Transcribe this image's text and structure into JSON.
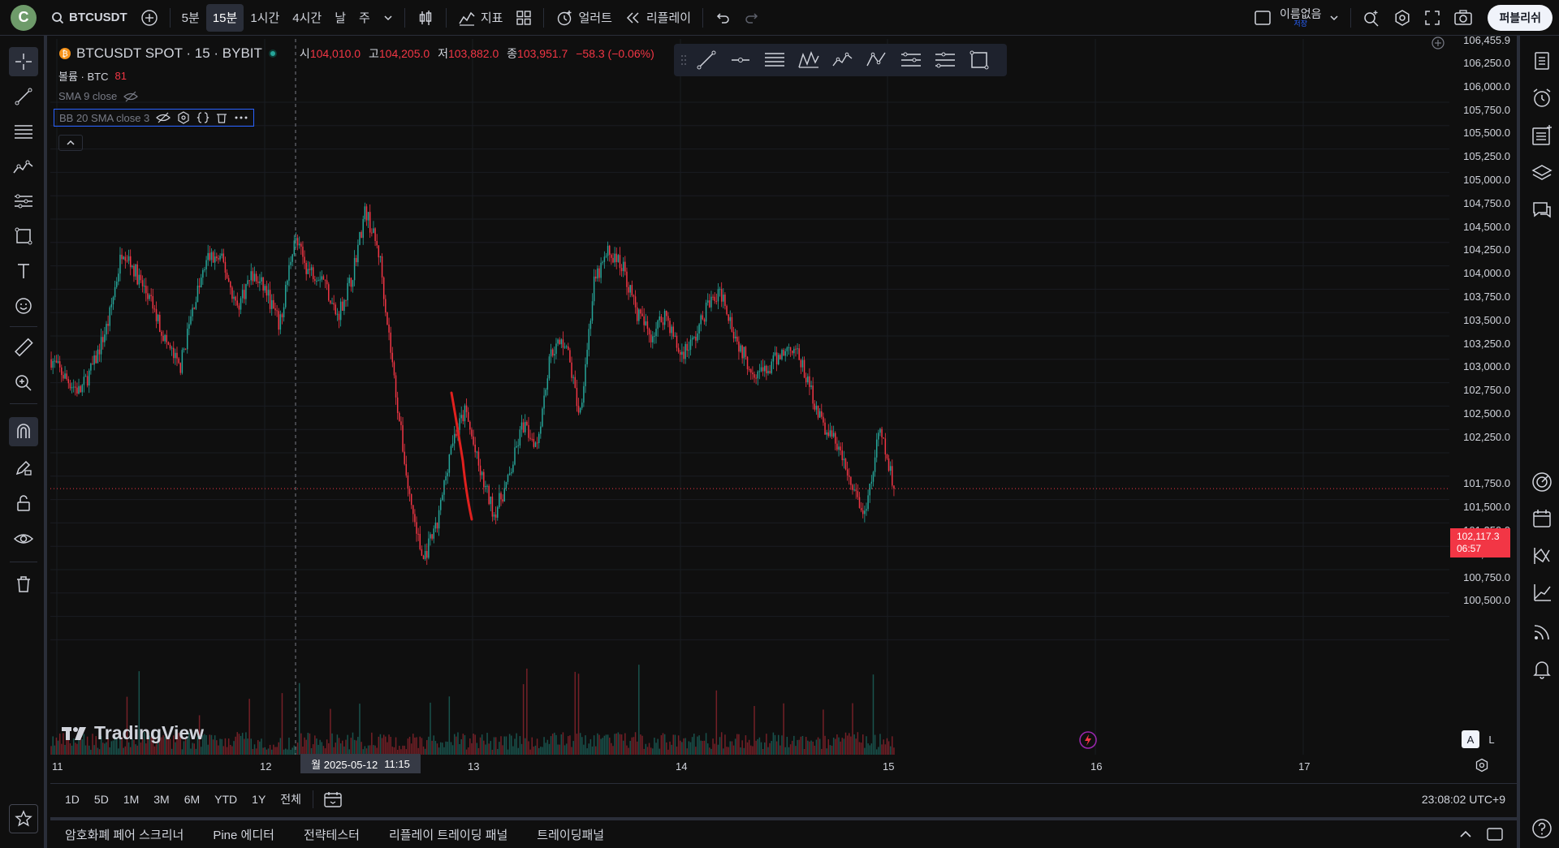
{
  "topbar": {
    "logo_letter": "C",
    "symbol": "BTCUSDT",
    "intervals": [
      "5분",
      "15분",
      "1시간",
      "4시간",
      "날",
      "주"
    ],
    "active_interval": "15분",
    "indicators_label": "지표",
    "alert_label": "얼러트",
    "replay_label": "리플레이",
    "layout_name": "이름없음",
    "layout_status": "저장",
    "publish_label": "퍼블리쉬"
  },
  "legend": {
    "title": "BTCUSDT SPOT · 15 · BYBIT",
    "open_key": "시",
    "open": "104,010.0",
    "high_key": "고",
    "high": "104,205.0",
    "low_key": "저",
    "low": "103,882.0",
    "close_key": "종",
    "close": "103,951.7",
    "change": "−58.3 (−0.06%)",
    "volume_label": "볼륨 · BTC",
    "volume_value": "81",
    "sma_label": "SMA 9 close",
    "bb_label": "BB 20 SMA close 3"
  },
  "price_axis": {
    "labels": [
      "106,455.9",
      "106,250.0",
      "106,000.0",
      "105,750.0",
      "105,500.0",
      "105,250.0",
      "105,000.0",
      "104,750.0",
      "104,500.0",
      "104,250.0",
      "104,000.0",
      "103,750.0",
      "103,500.0",
      "103,250.0",
      "103,000.0",
      "102,750.0",
      "102,500.0",
      "102,250.0",
      "101,750.0",
      "101,500.0",
      "101,250.0",
      "101,000.0",
      "100,750.0",
      "100,500.0"
    ],
    "current_price": "102,117.3",
    "countdown": "06:57"
  },
  "time_axis": {
    "labels": [
      "11",
      "12",
      "13",
      "14",
      "15",
      "16",
      "17"
    ],
    "crosshair_date": "월 2025-05-12",
    "crosshair_time": "11:15"
  },
  "range_bar": {
    "ranges": [
      "1D",
      "5D",
      "1M",
      "3M",
      "6M",
      "YTD",
      "1Y",
      "전체"
    ],
    "clock": "23:08:02 UTC+9"
  },
  "bottom_tabs": [
    "암호화폐 페어 스크리너",
    "Pine 에디터",
    "전략테스터",
    "리플레이 트레이딩 패널",
    "트레이딩패널"
  ],
  "branding": {
    "tv_text": "TradingView",
    "auto_label": "A",
    "log_label": "L"
  },
  "colors": {
    "up": "#26a69a",
    "down": "#f23645",
    "bg": "#0f0f0f",
    "accent": "#2962ff"
  },
  "chart_data": {
    "type": "candlestick",
    "symbol": "BTCUSDT",
    "exchange": "BYBIT",
    "interval": "15",
    "x_range": [
      "2025-05-11",
      "2025-05-17"
    ],
    "ylim": [
      100400,
      106455.9
    ],
    "last_price": 102117.3,
    "closes": [
      103500,
      103300,
      103150,
      103450,
      103900,
      104700,
      104400,
      104100,
      103700,
      103400,
      104100,
      104600,
      104550,
      104050,
      104400,
      104250,
      103850,
      104800,
      104450,
      104400,
      103950,
      104350,
      105100,
      104600,
      103300,
      102100,
      101350,
      101700,
      102600,
      102950,
      102300,
      101850,
      102200,
      102800,
      102600,
      103600,
      103700,
      102900,
      104300,
      104650,
      104500,
      104000,
      103750,
      104000,
      103550,
      103700,
      104100,
      104200,
      103700,
      103400,
      103350,
      103550,
      103650,
      103250,
      102800,
      102600,
      102150,
      101800,
      102750,
      102117.3
    ]
  }
}
